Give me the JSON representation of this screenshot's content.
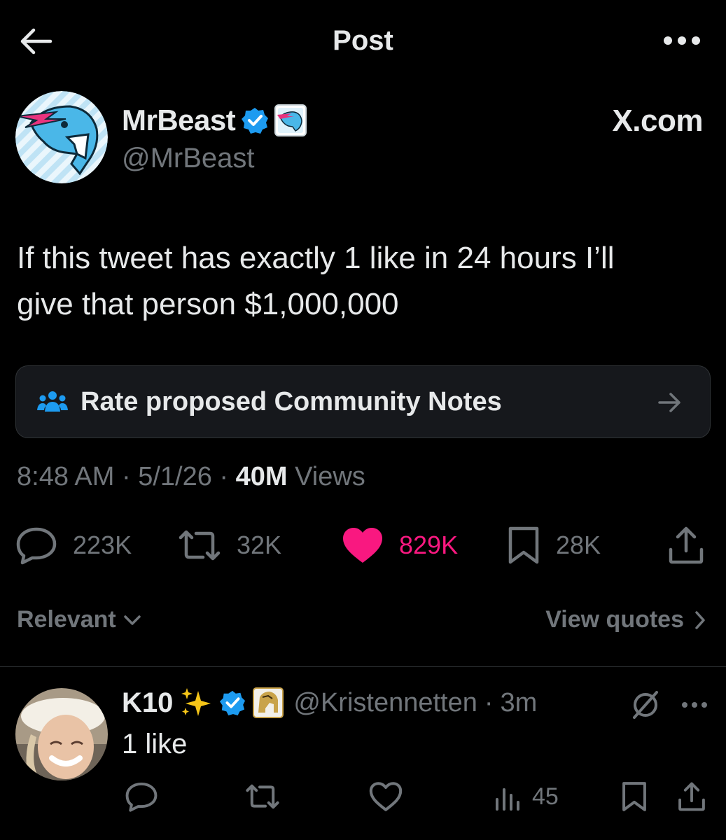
{
  "topbar": {
    "title": "Post",
    "back_icon": "arrow-left-icon",
    "more_icon": "more-horizontal-icon"
  },
  "author": {
    "name": "MrBeast",
    "handle": "@MrBeast",
    "verified": true,
    "badge_icon": "verified-badge-icon",
    "affiliate_icon": "beast-affiliate-icon",
    "right_label": "X.com"
  },
  "tweet": {
    "line1": "If this tweet has exactly 1 like in 24 hours I’ll",
    "line2": "give that person $1,000,000"
  },
  "community_notes": {
    "label": "Rate proposed Community Notes",
    "icon": "people-icon",
    "arrow_icon": "arrow-right-icon"
  },
  "meta": {
    "time": "8:48 AM",
    "sep": "·",
    "date": "5/1/26",
    "views_count": "40M",
    "views_label": "Views"
  },
  "actions": {
    "replies": "223K",
    "reposts": "32K",
    "likes": "829K",
    "bookmarks": "28K",
    "like_color": "#f91880"
  },
  "sort": {
    "left_label": "Relevant",
    "right_label": "View quotes"
  },
  "reply": {
    "name": "K10",
    "sparkle": "✨",
    "handle": "@Kristennetten",
    "sep": "·",
    "time": "3m",
    "text": "1 like",
    "views": "45"
  },
  "colors": {
    "background": "#000000",
    "text_primary": "#e7e9ea",
    "text_secondary": "#71767b",
    "verified_blue": "#1d9bf0",
    "like_pink": "#f91880",
    "border": "#2f3336"
  }
}
